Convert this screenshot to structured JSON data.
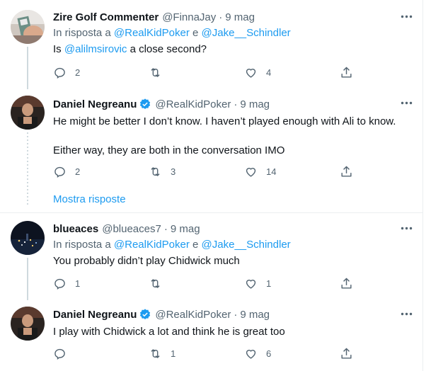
{
  "tweets": [
    {
      "name": "Zire Golf Commenter",
      "handle": "@FinnaJay",
      "time": "9 mag",
      "reply_prefix": "In risposta a",
      "reply_user1": "@RealKidPoker",
      "reply_and": "e",
      "reply_user2": "@Jake__Schindler",
      "mention": "@alilmsirovic",
      "text": "a close second?",
      "text_prefix": "Is",
      "replies": "2",
      "retweets": "",
      "likes": "4"
    },
    {
      "name": "Daniel Negreanu",
      "handle": "@RealKidPoker",
      "time": "9 mag",
      "text1": "He might be better I don’t know. I haven’t played enough with Ali to know.",
      "text2": "Either way, they are both in the conversation IMO",
      "replies": "2",
      "retweets": "3",
      "likes": "14"
    },
    {
      "name": "blueaces",
      "handle": "@blueaces7",
      "time": "9 mag",
      "reply_prefix": "In risposta a",
      "reply_user1": "@RealKidPoker",
      "reply_and": "e",
      "reply_user2": "@Jake__Schindler",
      "text": "You probably didn’t play Chidwick much",
      "replies": "1",
      "retweets": "",
      "likes": "1"
    },
    {
      "name": "Daniel Negreanu",
      "handle": "@RealKidPoker",
      "time": "9 mag",
      "text": "I play with Chidwick a lot and think he is great too",
      "replies": "",
      "retweets": "1",
      "likes": "6"
    }
  ],
  "show_replies": "Mostra risposte",
  "separator": "·",
  "colors": {
    "link": "#1d9bf0",
    "secondary": "#536471",
    "verified": "#1d9bf0",
    "border": "#ebeef0"
  }
}
